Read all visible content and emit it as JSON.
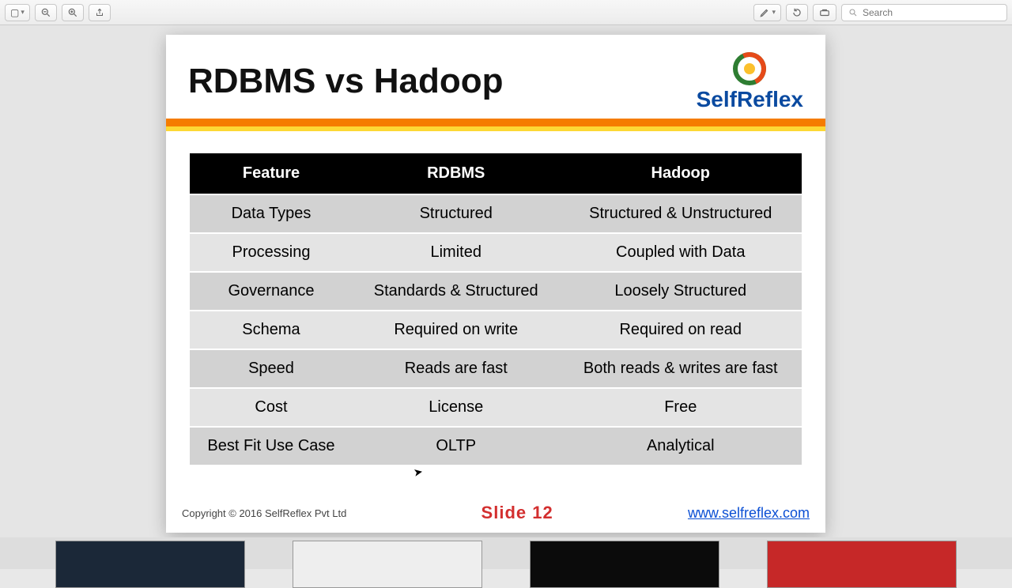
{
  "toolbar": {
    "search_placeholder": "Search"
  },
  "slide": {
    "title": "RDBMS vs Hadoop",
    "logo_text": "SelfReflex",
    "copyright": "Copyright © 2016 SelfReflex Pvt Ltd",
    "slide_label": "Slide 12",
    "website": "www.selfreflex.com",
    "table": {
      "headers": [
        "Feature",
        "RDBMS",
        "Hadoop"
      ],
      "rows": [
        [
          "Data Types",
          "Structured",
          "Structured & Unstructured"
        ],
        [
          "Processing",
          "Limited",
          "Coupled with Data"
        ],
        [
          "Governance",
          "Standards & Structured",
          "Loosely Structured"
        ],
        [
          "Schema",
          "Required on write",
          "Required on read"
        ],
        [
          "Speed",
          "Reads are fast",
          "Both reads & writes are fast"
        ],
        [
          "Cost",
          "License",
          "Free"
        ],
        [
          "Best Fit Use Case",
          "OLTP",
          "Analytical"
        ]
      ]
    }
  }
}
